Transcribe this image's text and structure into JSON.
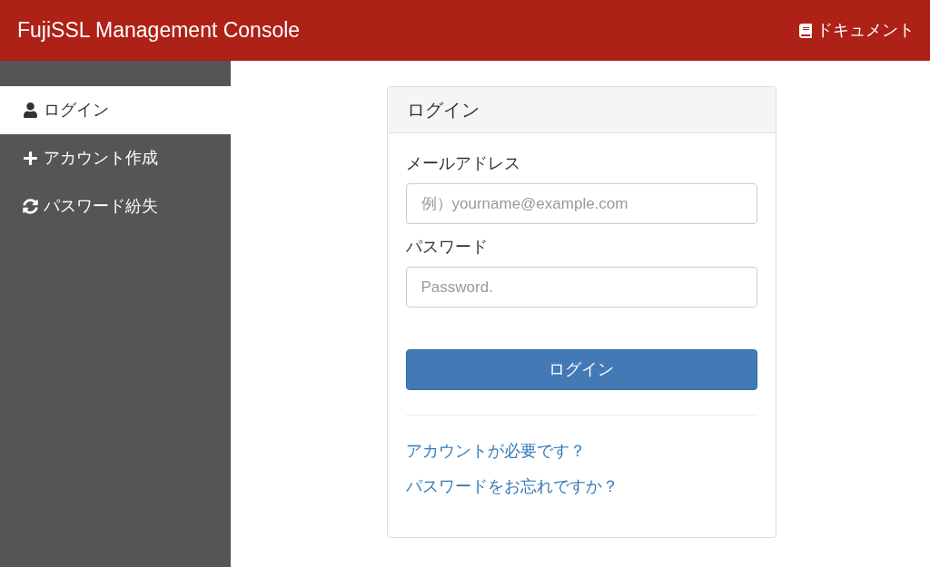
{
  "header": {
    "title": "FujiSSL Management Console",
    "docs_link": "ドキュメント"
  },
  "sidebar": {
    "items": [
      {
        "label": "ログイン",
        "kind": "user",
        "selected": true
      },
      {
        "label": "アカウント作成",
        "kind": "plus",
        "selected": false
      },
      {
        "label": "パスワード紛失",
        "kind": "refresh",
        "selected": false
      }
    ]
  },
  "login_panel": {
    "title": "ログイン",
    "fields": [
      {
        "label": "メールアドレス",
        "placeholder": "例）yourname@example.com"
      },
      {
        "label": "パスワード",
        "placeholder": "Password."
      }
    ],
    "submit": "ログイン",
    "links": [
      "アカウントが必要です？",
      "パスワードをお忘れですか？"
    ]
  }
}
